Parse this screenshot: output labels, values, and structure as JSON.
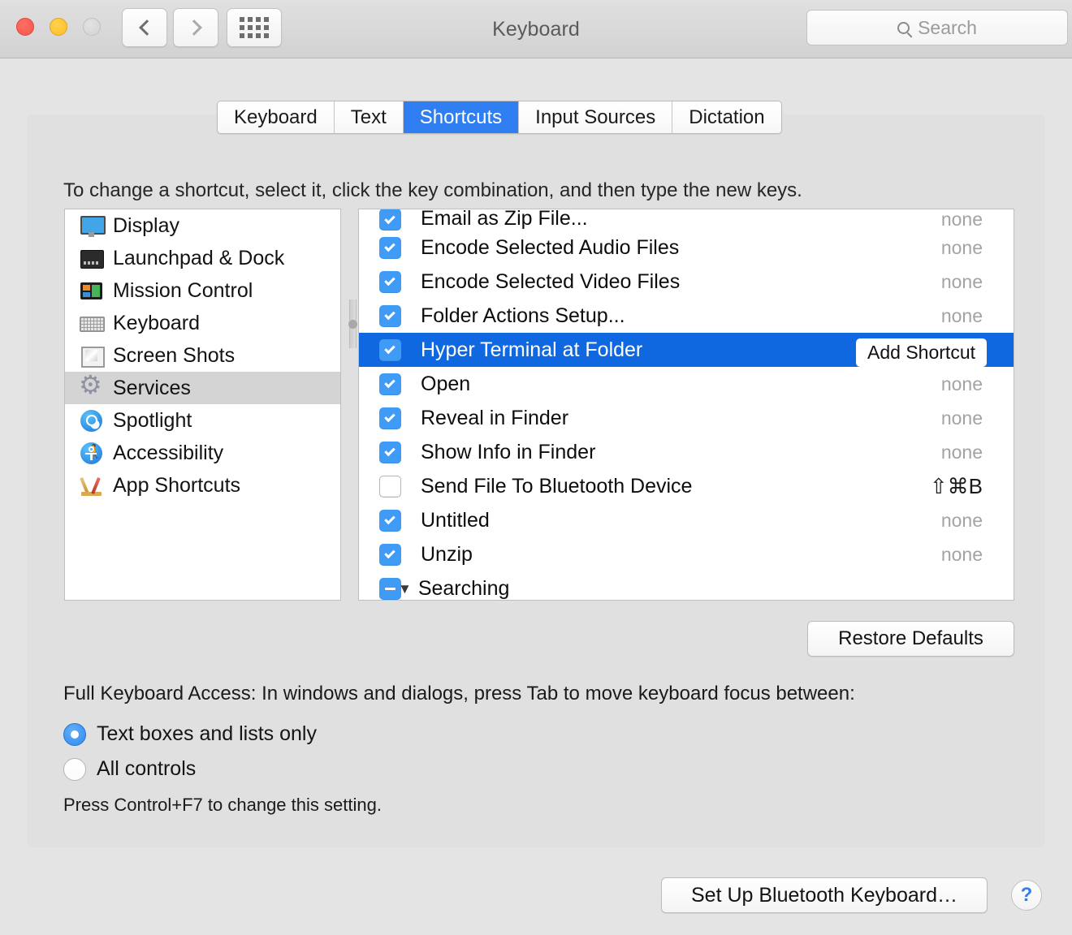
{
  "window": {
    "title": "Keyboard",
    "traffic_lights": [
      "close",
      "minimize",
      "zoom"
    ],
    "nav_back": "back",
    "nav_forward": "forward",
    "grid_button": "show-all"
  },
  "search": {
    "placeholder": "Search",
    "value": ""
  },
  "tabs": [
    {
      "label": "Keyboard",
      "active": false
    },
    {
      "label": "Text",
      "active": false
    },
    {
      "label": "Shortcuts",
      "active": true
    },
    {
      "label": "Input Sources",
      "active": false
    },
    {
      "label": "Dictation",
      "active": false
    }
  ],
  "hint": "To change a shortcut, select it, click the key combination, and then type the new keys.",
  "sidebar": {
    "items": [
      {
        "label": "Display",
        "icon": "display-icon",
        "selected": false
      },
      {
        "label": "Launchpad & Dock",
        "icon": "dock-icon",
        "selected": false
      },
      {
        "label": "Mission Control",
        "icon": "mission-control-icon",
        "selected": false
      },
      {
        "label": "Keyboard",
        "icon": "keyboard-icon",
        "selected": false
      },
      {
        "label": "Screen Shots",
        "icon": "screenshots-icon",
        "selected": false
      },
      {
        "label": "Services",
        "icon": "services-gear-icon",
        "selected": true
      },
      {
        "label": "Spotlight",
        "icon": "spotlight-icon",
        "selected": false
      },
      {
        "label": "Accessibility",
        "icon": "accessibility-icon",
        "selected": false
      },
      {
        "label": "App Shortcuts",
        "icon": "app-shortcuts-icon",
        "selected": false
      }
    ]
  },
  "shortcuts": {
    "rows": [
      {
        "name": "Email as Zip File...",
        "key": "none",
        "checked": "on",
        "selected": false,
        "type": "item",
        "clipped": true
      },
      {
        "name": "Encode Selected Audio Files",
        "key": "none",
        "checked": "on",
        "selected": false,
        "type": "item"
      },
      {
        "name": "Encode Selected Video Files",
        "key": "none",
        "checked": "on",
        "selected": false,
        "type": "item"
      },
      {
        "name": "Folder Actions Setup...",
        "key": "none",
        "checked": "on",
        "selected": false,
        "type": "item"
      },
      {
        "name": "Hyper Terminal at Folder",
        "key": "Add Shortcut",
        "checked": "on",
        "selected": true,
        "type": "item"
      },
      {
        "name": "Open",
        "key": "none",
        "checked": "on",
        "selected": false,
        "type": "item"
      },
      {
        "name": "Reveal in Finder",
        "key": "none",
        "checked": "on",
        "selected": false,
        "type": "item"
      },
      {
        "name": "Show Info in Finder",
        "key": "none",
        "checked": "on",
        "selected": false,
        "type": "item"
      },
      {
        "name": "Send File To Bluetooth Device",
        "key": "⇧⌘B",
        "checked": "off",
        "selected": false,
        "type": "item",
        "bound": true
      },
      {
        "name": "Untitled",
        "key": "none",
        "checked": "on",
        "selected": false,
        "type": "item"
      },
      {
        "name": "Unzip",
        "key": "none",
        "checked": "on",
        "selected": false,
        "type": "item"
      },
      {
        "name": "Searching",
        "key": "",
        "checked": "mixed",
        "selected": false,
        "type": "group",
        "triangle": "▼"
      }
    ],
    "add_shortcut_label": "Add Shortcut"
  },
  "restore_defaults_label": "Restore Defaults",
  "full_keyboard_access": {
    "label": "Full Keyboard Access: In windows and dialogs, press Tab to move keyboard focus between:",
    "options": [
      {
        "label": "Text boxes and lists only",
        "selected": true
      },
      {
        "label": "All controls",
        "selected": false
      }
    ],
    "note": "Press Control+F7 to change this setting."
  },
  "footer": {
    "bluetooth_button": "Set Up Bluetooth Keyboard…",
    "help_button": "?"
  },
  "colors": {
    "accent_blue": "#2f7ff2",
    "selection_blue": "#1068e0",
    "checkbox_blue": "#3f9bf5",
    "window_bg": "#e4e4e4",
    "panel_bg": "#e0e0e0"
  }
}
